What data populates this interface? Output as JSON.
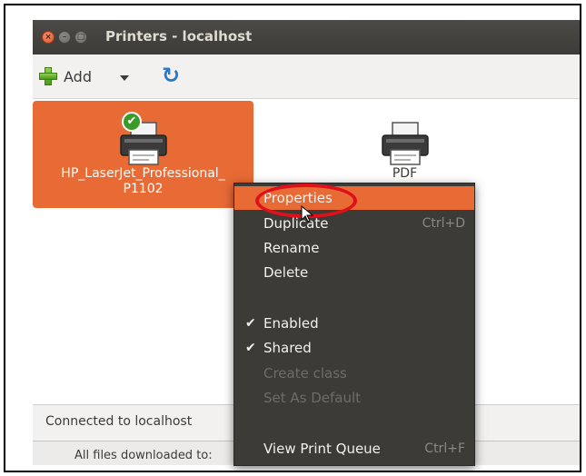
{
  "window": {
    "title": "Printers - localhost",
    "buttons": {
      "close": "×",
      "minimize": "–",
      "maximize": "□"
    }
  },
  "toolbar": {
    "add_label": "Add",
    "add_icon": "plus-icon",
    "refresh_icon": "refresh-icon",
    "refresh_glyph": "↻"
  },
  "printers": [
    {
      "name": "HP_LaserJet_Professional_\nP1102",
      "line1": "HP_LaserJet_Professional_",
      "line2": "P1102",
      "selected": true,
      "default_badge": "✔"
    },
    {
      "name": "PDF",
      "line1": "PDF",
      "line2": "",
      "selected": false
    }
  ],
  "context_menu": {
    "items": [
      {
        "label": "Properties",
        "shortcut": "",
        "checked": false,
        "enabled": true,
        "highlighted": true
      },
      {
        "label": "Duplicate",
        "shortcut": "Ctrl+D",
        "checked": false,
        "enabled": true
      },
      {
        "label": "Rename",
        "shortcut": "",
        "checked": false,
        "enabled": true
      },
      {
        "label": "Delete",
        "shortcut": "",
        "checked": false,
        "enabled": true
      },
      {
        "label": "Enabled",
        "shortcut": "",
        "checked": true,
        "enabled": true
      },
      {
        "label": "Shared",
        "shortcut": "",
        "checked": true,
        "enabled": true
      },
      {
        "label": "Create class",
        "shortcut": "",
        "checked": false,
        "enabled": false
      },
      {
        "label": "Set As Default",
        "shortcut": "",
        "checked": false,
        "enabled": false
      },
      {
        "label": "View Print Queue",
        "shortcut": "Ctrl+F",
        "checked": false,
        "enabled": true
      }
    ],
    "check_glyph": "✔"
  },
  "statusbar": {
    "text": "Connected to localhost"
  },
  "background_text": "All files downloaded to:",
  "colors": {
    "accent": "#e86a35",
    "titlebar": "#3c3b37",
    "highlight_ring": "#e0101a"
  }
}
